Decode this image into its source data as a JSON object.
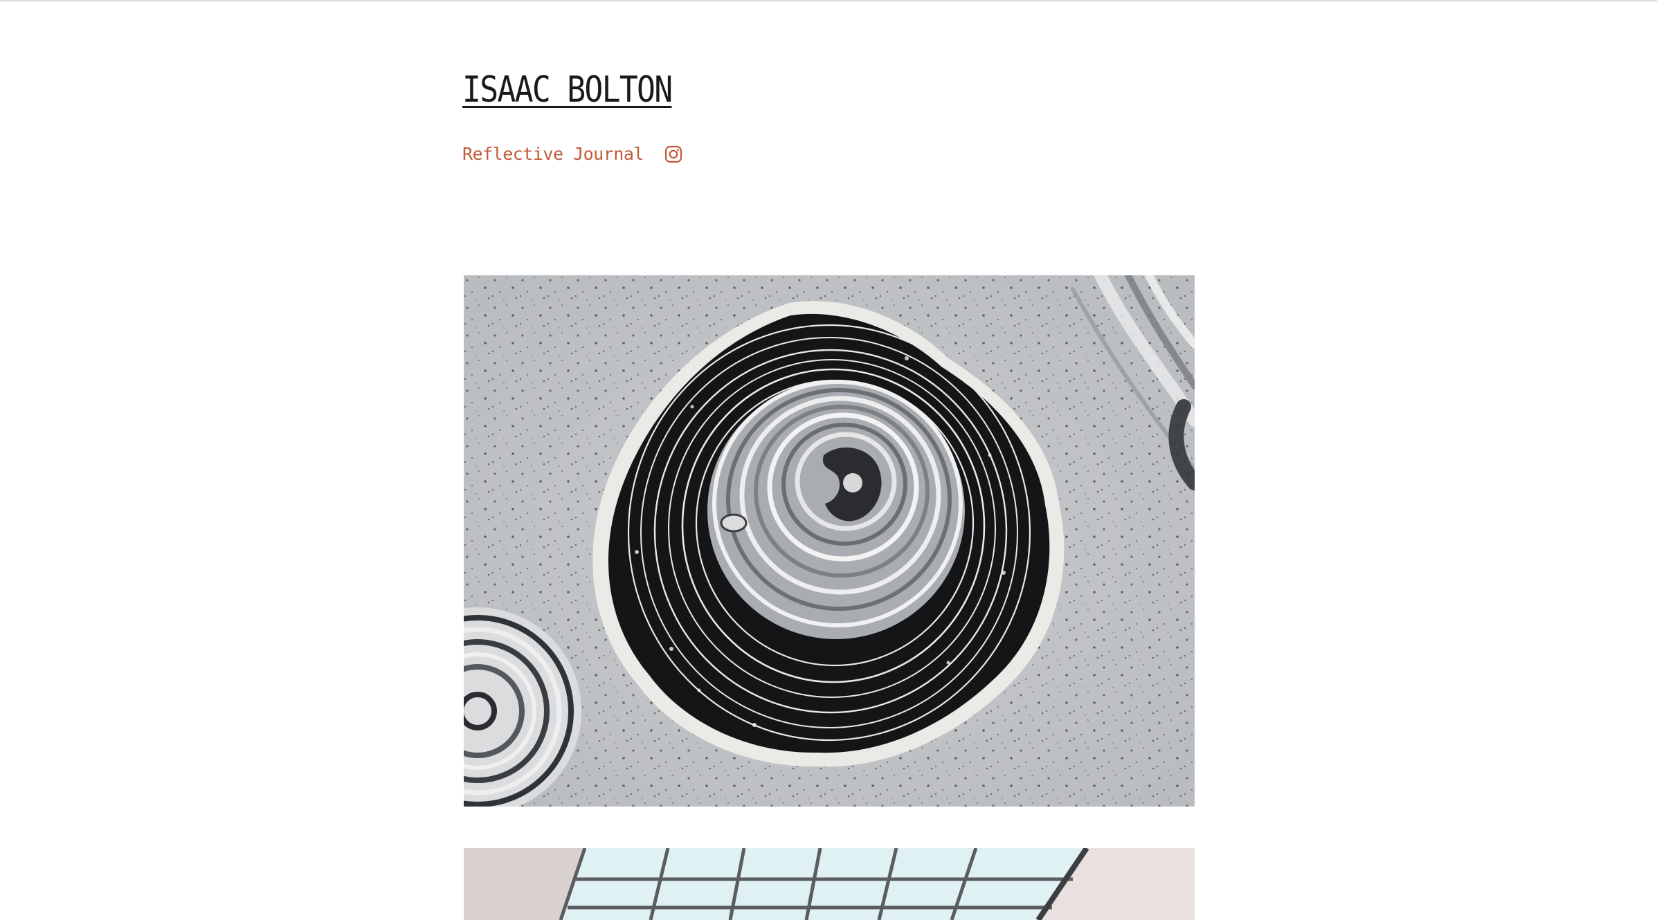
{
  "site": {
    "title": "ISAAC BOLTON"
  },
  "nav": {
    "items": [
      {
        "label": "Reflective Journal"
      }
    ],
    "social_icon": "instagram-icon"
  },
  "colors": {
    "accent": "#c25a35",
    "title": "#1a1a1a",
    "background": "#ffffff"
  },
  "gallery": [
    {
      "subject": "black-and-white-fluid-pour-painting"
    },
    {
      "subject": "gallery-skylight-ceiling"
    }
  ]
}
